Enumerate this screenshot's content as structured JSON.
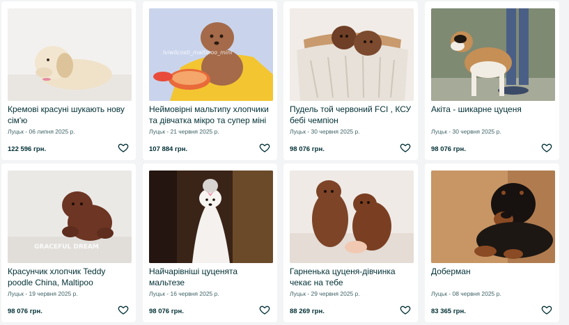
{
  "listings": [
    {
      "title": "Кремові красуні шукають нову сім'ю",
      "meta": "Луцьк - 06 липня 2025 р.",
      "price": "122 596 грн."
    },
    {
      "title": "Неймовірні мальтипу хлопчики та дівчатка мікро та супер міні",
      "meta": "Луцьк - 21 червня 2025 р.",
      "price": "107 884 грн.",
      "watermark": "lviwlicosti_maltipoo_mini"
    },
    {
      "title": "Пудель той червоний FCI , КСУ бебі чемпіон",
      "meta": "Луцьк - 30 червня 2025 р.",
      "price": "98 076 грн."
    },
    {
      "title": "Акіта - шикарне цуценя",
      "meta": "Луцьк - 30 червня 2025 р.",
      "price": "98 076 грн."
    },
    {
      "title": "Красунчик хлопчик Teddy poodle China, Maltipoo",
      "meta": "Луцьк - 19 червня 2025 р.",
      "price": "98 076 грн.",
      "watermark": "GRACEFUL DREAM"
    },
    {
      "title": "Найчарівніші цуценята мальтезе",
      "meta": "Луцьк - 16 червня 2025 р.",
      "price": "98 076 грн."
    },
    {
      "title": "Гарненька цуценя-дівчинка чекає на тебе",
      "meta": "Луцьк - 29 червня 2025 р.",
      "price": "88 269 грн."
    },
    {
      "title": "Доберман",
      "meta": "Луцьк - 08 червня 2025 р.",
      "price": "83 365 грн."
    }
  ],
  "icons": {
    "favorite": "heart-outline-icon"
  },
  "colors": {
    "background": "#f2f4f5",
    "card": "#ffffff",
    "text": "#002f34",
    "meta": "#406367"
  }
}
